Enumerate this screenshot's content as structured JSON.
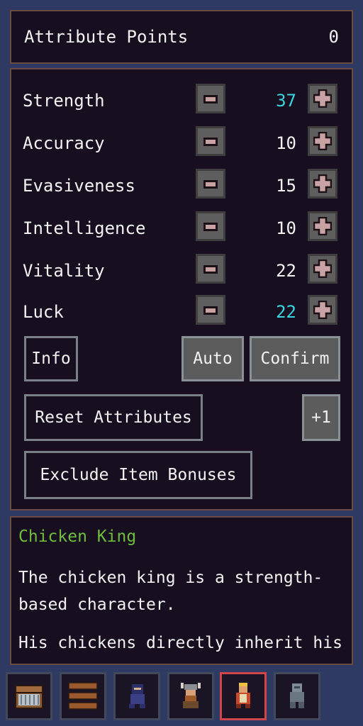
{
  "attribute_points": {
    "label": "Attribute Points",
    "value": "0"
  },
  "attributes": [
    {
      "name": "Strength",
      "value": "37",
      "highlight": true
    },
    {
      "name": "Accuracy",
      "value": "10",
      "highlight": false
    },
    {
      "name": "Evasiveness",
      "value": "15",
      "highlight": false
    },
    {
      "name": "Intelligence",
      "value": "10",
      "highlight": false
    },
    {
      "name": "Vitality",
      "value": "22",
      "highlight": false
    },
    {
      "name": "Luck",
      "value": "22",
      "highlight": true
    }
  ],
  "buttons": {
    "info": "Info",
    "auto": "Auto",
    "confirm": "Confirm",
    "reset": "Reset Attributes",
    "plus_one": "+1",
    "exclude": "Exclude Item Bonuses"
  },
  "character": {
    "name": "Chicken King",
    "desc_1": "The chicken king is a strength-based character.",
    "desc_2": "His chickens directly inherit his characteristics. A chosen chicken"
  },
  "bottom_bar": [
    {
      "icon": "treasure-chest-icon",
      "active": false
    },
    {
      "icon": "menu-bars-icon",
      "active": false
    },
    {
      "icon": "ninja-character-icon",
      "active": false
    },
    {
      "icon": "viking-character-icon",
      "active": false
    },
    {
      "icon": "chicken-king-character-icon",
      "active": true
    },
    {
      "icon": "robot-character-icon",
      "active": false
    }
  ],
  "colors": {
    "highlight_value": "#39d5e0",
    "character_name": "#6ebe3c",
    "active_slot": "#d0454b"
  }
}
